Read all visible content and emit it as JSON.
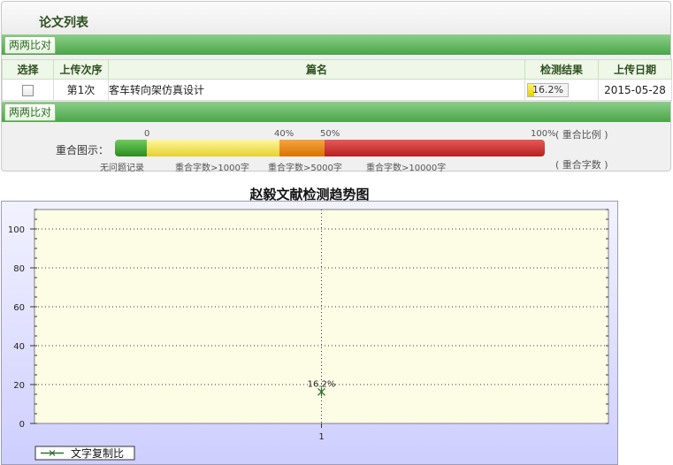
{
  "panel": {
    "title": "论文列表",
    "compare_button_label": "两两比对",
    "columns": [
      "选择",
      "上传次序",
      "篇名",
      "检测结果",
      "上传日期"
    ],
    "rows": [
      {
        "order": "第1次",
        "title": "客车转向架仿真设计",
        "result": "16.2%",
        "result_value": 16.2,
        "date": "2015-05-28"
      }
    ]
  },
  "overlap_legend": {
    "label": "重合图示：",
    "ticks": [
      "0",
      "40%",
      "50%",
      "100%"
    ],
    "ratio_label": "( 重合比例 )",
    "count_label": "( 重合字数 )",
    "segments": [
      {
        "label": "无问题记录",
        "color": "#3ea52f"
      },
      {
        "label": "重合字数>1000字",
        "color": "#f1e04a"
      },
      {
        "label": "重合字数>5000字",
        "color": "#e88a10"
      },
      {
        "label": "重合字数>10000字",
        "color": "#cc3331"
      }
    ]
  },
  "chart_data": {
    "type": "line",
    "title": "赵毅文献检测趋势图",
    "categories": [
      "1"
    ],
    "series": [
      {
        "name": "文字复制比",
        "values": [
          16.2
        ],
        "labels": [
          "16.2%"
        ],
        "color": "#2f6b2f"
      }
    ],
    "ylim": [
      0,
      110
    ],
    "yticks": [
      0,
      20,
      40,
      60,
      80,
      100
    ],
    "grid": true,
    "legend_position": "bottom-left",
    "plot_bg": "#fdfde6"
  }
}
